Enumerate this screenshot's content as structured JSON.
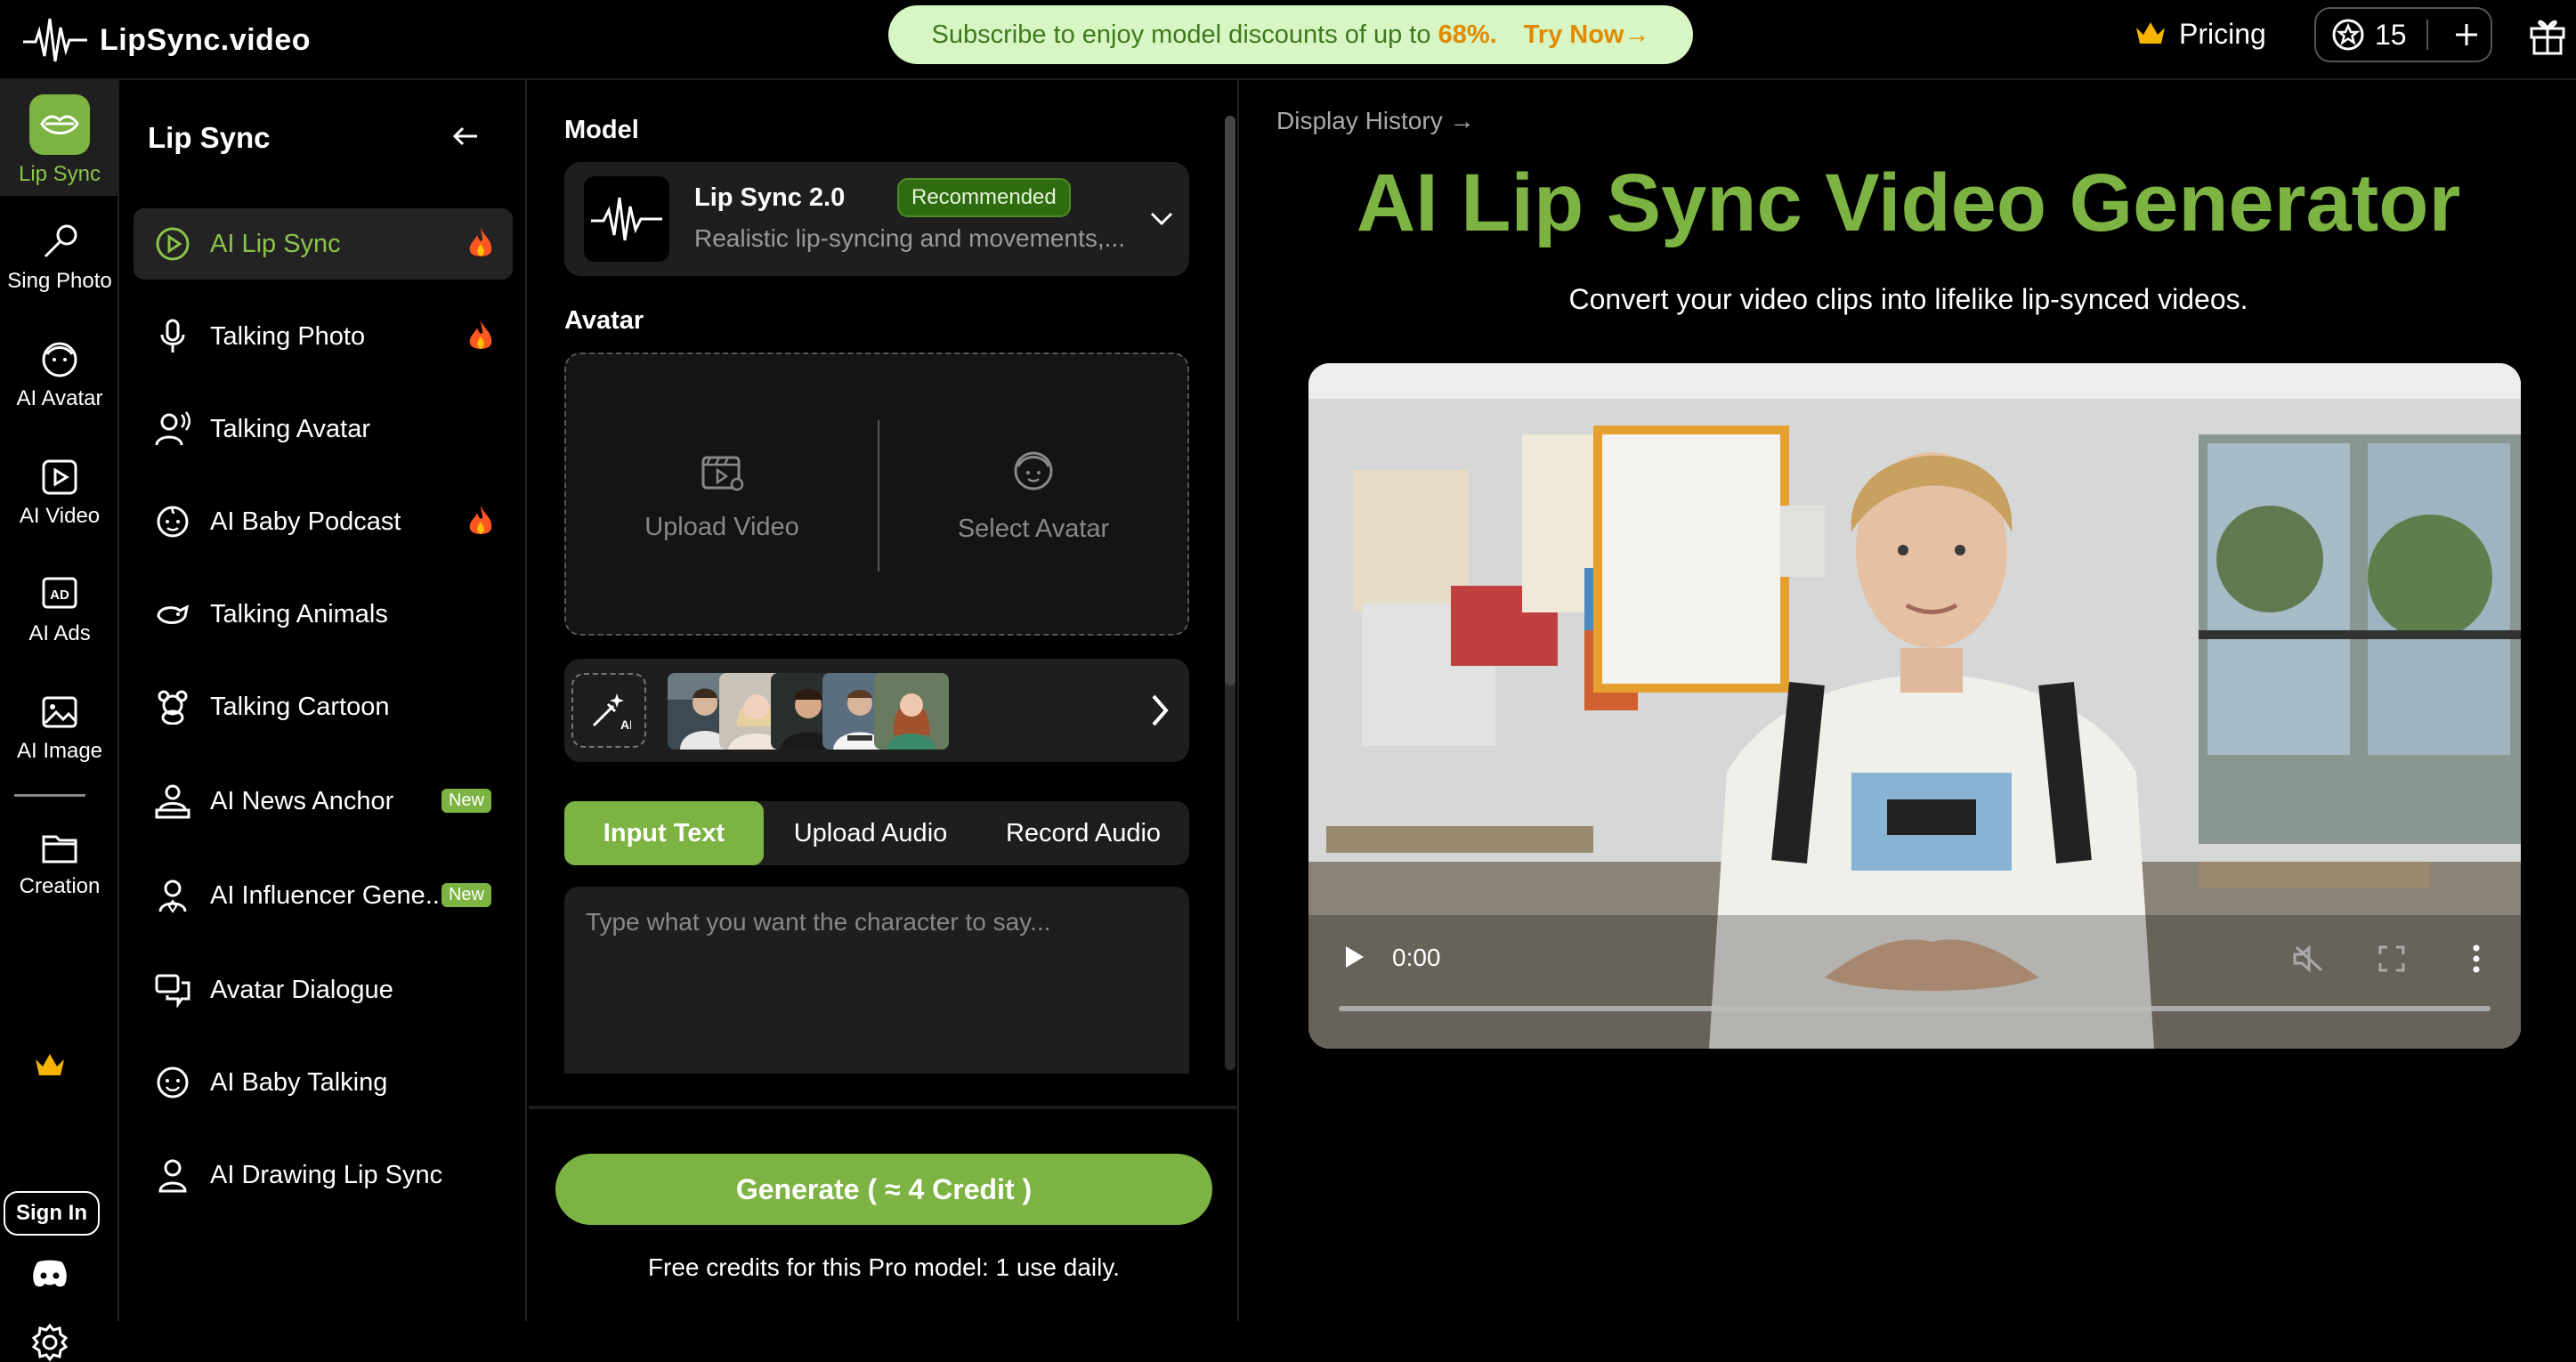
{
  "brand": {
    "name": "LipSync.video"
  },
  "promo": {
    "message": "Subscribe to enjoy model discounts of up to",
    "percent": "68%.",
    "cta": "Try Now→"
  },
  "header": {
    "pricing": "Pricing",
    "credits": "15"
  },
  "rail": [
    {
      "label": "Lip Sync"
    },
    {
      "label": "Sing Photo"
    },
    {
      "label": "AI Avatar"
    },
    {
      "label": "AI Video"
    },
    {
      "label": "AI Ads"
    },
    {
      "label": "AI Image"
    },
    {
      "label": "Creation"
    }
  ],
  "rail_signin": "Sign In",
  "sidebar": {
    "title": "Lip Sync",
    "items": [
      {
        "label": "AI Lip Sync"
      },
      {
        "label": "Talking Photo"
      },
      {
        "label": "Talking Avatar"
      },
      {
        "label": "AI Baby Podcast"
      },
      {
        "label": "Talking Animals"
      },
      {
        "label": "Talking Cartoon"
      },
      {
        "label": "AI News Anchor",
        "badge": "New"
      },
      {
        "label": "AI Influencer Gene...",
        "badge": "New"
      },
      {
        "label": "Avatar Dialogue"
      },
      {
        "label": "AI Baby Talking"
      },
      {
        "label": "AI Drawing Lip Sync"
      }
    ]
  },
  "form": {
    "model_label": "Model",
    "model_name": "Lip Sync 2.0",
    "model_badge": "Recommended",
    "model_desc": "Realistic lip-syncing and movements,...",
    "avatar_label": "Avatar",
    "upload_video": "Upload Video",
    "select_avatar": "Select Avatar",
    "tabs": [
      "Input Text",
      "Upload Audio",
      "Record Audio"
    ],
    "text_placeholder": "Type what you want the character to say...",
    "generate": "Generate ( ≈ 4 Credit )",
    "free_note": "Free credits for this Pro model: 1 use daily."
  },
  "main": {
    "history": "Display History →",
    "title": "AI Lip Sync Video Generator",
    "subtitle": "Convert your video clips into lifelike lip-synced videos.",
    "video_time": "0:00"
  },
  "colors": {
    "accent": "#7cb342",
    "promo_bg": "#d8f5c4",
    "promo_highlight": "#e08a00"
  }
}
